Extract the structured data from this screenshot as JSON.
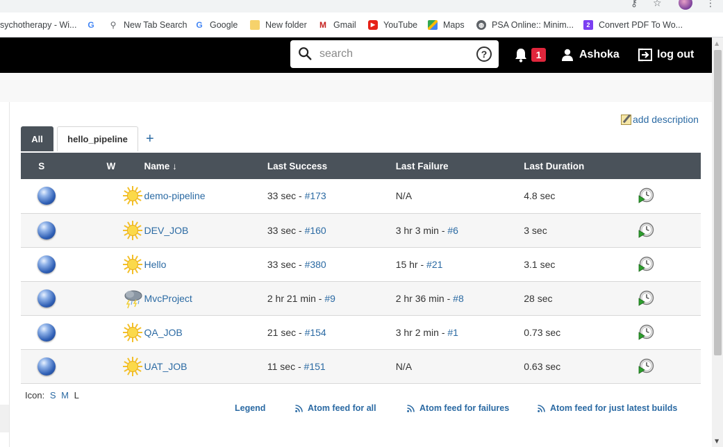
{
  "browser": {
    "bookmarks": [
      {
        "label": "sychotherapy - Wi...",
        "icon": "none"
      },
      {
        "label": "",
        "icon": "google-icon"
      },
      {
        "label": "New Tab Search",
        "icon": "search-icon"
      },
      {
        "label": "Google",
        "icon": "google-icon"
      },
      {
        "label": "New folder",
        "icon": "folder-icon"
      },
      {
        "label": "Gmail",
        "icon": "gmail-icon"
      },
      {
        "label": "YouTube",
        "icon": "youtube-icon"
      },
      {
        "label": "Maps",
        "icon": "maps-icon"
      },
      {
        "label": "PSA Online:: Minim...",
        "icon": "globe-icon"
      },
      {
        "label": "Convert PDF To Wo...",
        "icon": "pdf-icon"
      }
    ]
  },
  "header": {
    "search_placeholder": "search",
    "help_glyph": "?",
    "notification_count": "1",
    "username": "Ashoka",
    "logout_label": "log out"
  },
  "view": {
    "add_description": "add description",
    "tabs": [
      {
        "label": "All",
        "active": true
      },
      {
        "label": "hello_pipeline",
        "active": false
      }
    ],
    "add_tab_glyph": "+"
  },
  "table": {
    "columns": {
      "s": "S",
      "w": "W",
      "name": "Name",
      "name_sort": "↓",
      "last_success": "Last Success",
      "last_failure": "Last Failure",
      "last_duration": "Last Duration"
    },
    "rows": [
      {
        "name": "demo-pipeline",
        "weather": "sunny",
        "ls_time": "33 sec - ",
        "ls_build": "#173",
        "lf_time": "N/A",
        "lf_build": "",
        "duration": "4.8 sec"
      },
      {
        "name": "DEV_JOB",
        "weather": "sunny",
        "ls_time": "33 sec - ",
        "ls_build": "#160",
        "lf_time": "3 hr 3 min - ",
        "lf_build": "#6",
        "duration": "3 sec"
      },
      {
        "name": "Hello",
        "weather": "sunny",
        "ls_time": "33 sec - ",
        "ls_build": "#380",
        "lf_time": "15 hr - ",
        "lf_build": "#21",
        "duration": "3.1 sec"
      },
      {
        "name": "MvcProject",
        "weather": "stormy",
        "ls_time": "2 hr 21 min - ",
        "ls_build": "#9",
        "lf_time": "2 hr 36 min - ",
        "lf_build": "#8",
        "duration": "28 sec"
      },
      {
        "name": "QA_JOB",
        "weather": "sunny",
        "ls_time": "21 sec - ",
        "ls_build": "#154",
        "lf_time": "3 hr 2 min - ",
        "lf_build": "#1",
        "duration": "0.73 sec"
      },
      {
        "name": "UAT_JOB",
        "weather": "sunny",
        "ls_time": "11 sec - ",
        "ls_build": "#151",
        "lf_time": "N/A",
        "lf_build": "",
        "duration": "0.63 sec"
      }
    ]
  },
  "footer": {
    "icon_label": "Icon:",
    "sizes": [
      "S",
      "M",
      "L"
    ],
    "legend": "Legend",
    "feed_all": "Atom feed for all",
    "feed_failures": "Atom feed for failures",
    "feed_latest": "Atom feed for just latest builds"
  },
  "colors": {
    "header_bg": "#000000",
    "table_header_bg": "#4a525a",
    "link": "#2b6aa3",
    "badge": "#e0263c"
  }
}
